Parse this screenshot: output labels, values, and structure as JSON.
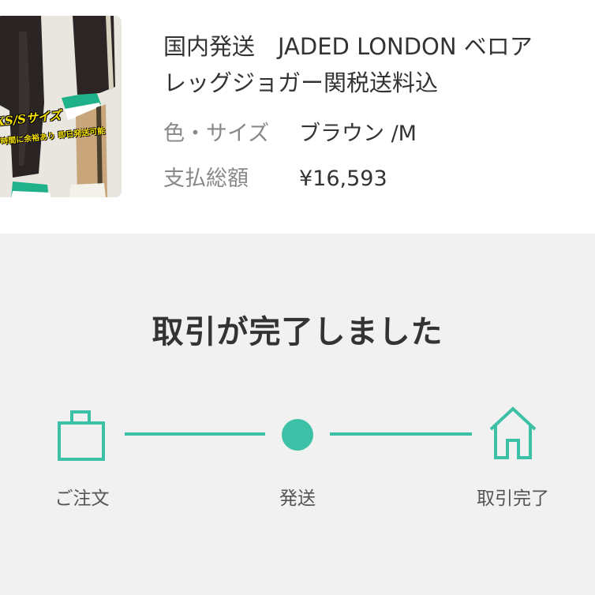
{
  "product": {
    "title_line1": "国内発送　JADED LONDON ベロア",
    "title_line2": "レッグジョガー関税送料込",
    "variant_label": "色・サイズ",
    "variant_value": "ブラウン /M",
    "total_label": "支払総額",
    "total_value": "¥16,593",
    "thumbnail": {
      "caption": "XS/Sサイズ",
      "caption_sub": "時間に余裕あり 即日発送可能",
      "icon": "product-photo"
    }
  },
  "status": {
    "title": "取引が完了しました"
  },
  "progress": {
    "accent_color": "#3cc0a6",
    "steps": [
      {
        "label": "ご注文",
        "icon": "shopping-bag-icon"
      },
      {
        "label": "発送",
        "icon": "dot-icon"
      },
      {
        "label": "取引完了",
        "icon": "house-icon"
      }
    ],
    "current_step": 3
  }
}
